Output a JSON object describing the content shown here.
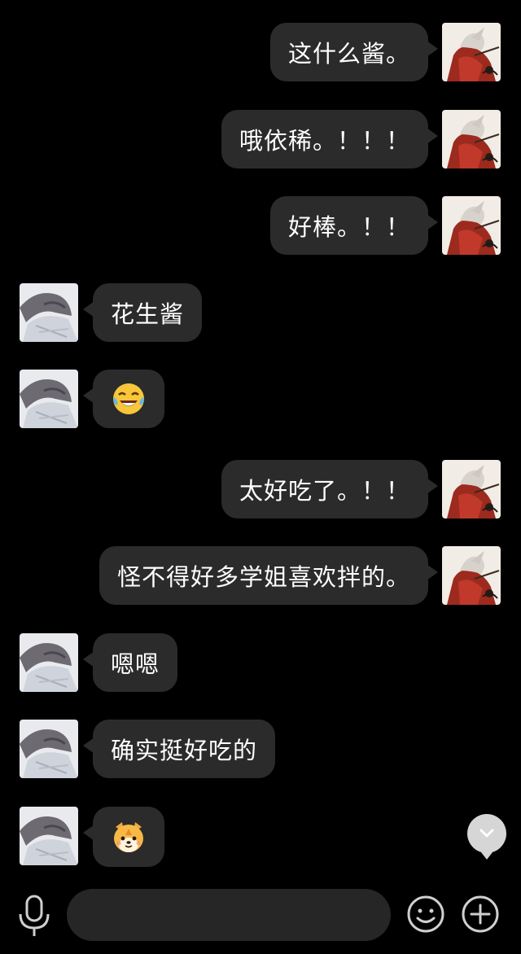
{
  "messages": [
    {
      "side": "right",
      "text": "这什么酱。"
    },
    {
      "side": "right",
      "text": "哦依稀。！！！"
    },
    {
      "side": "right",
      "text": "好棒。！！"
    },
    {
      "side": "left",
      "text": "花生酱"
    },
    {
      "side": "left",
      "emoji": "laughing-tears"
    },
    {
      "side": "right",
      "text": "太好吃了。！！"
    },
    {
      "side": "right",
      "text": "怪不得好多学姐喜欢拌的。"
    },
    {
      "side": "left",
      "text": "嗯嗯"
    },
    {
      "side": "left",
      "text": "确实挺好吃的"
    },
    {
      "side": "left",
      "emoji": "dog-sticker"
    }
  ],
  "input": {
    "value": ""
  },
  "icons": {
    "voice": "microphone-icon",
    "emoji": "smiley-icon",
    "more": "plus-icon",
    "scroll": "chevron-down-icon"
  },
  "colors": {
    "background": "#000000",
    "bubble": "#2b2b2b",
    "input": "#262626",
    "icon": "#cfcfcf"
  }
}
